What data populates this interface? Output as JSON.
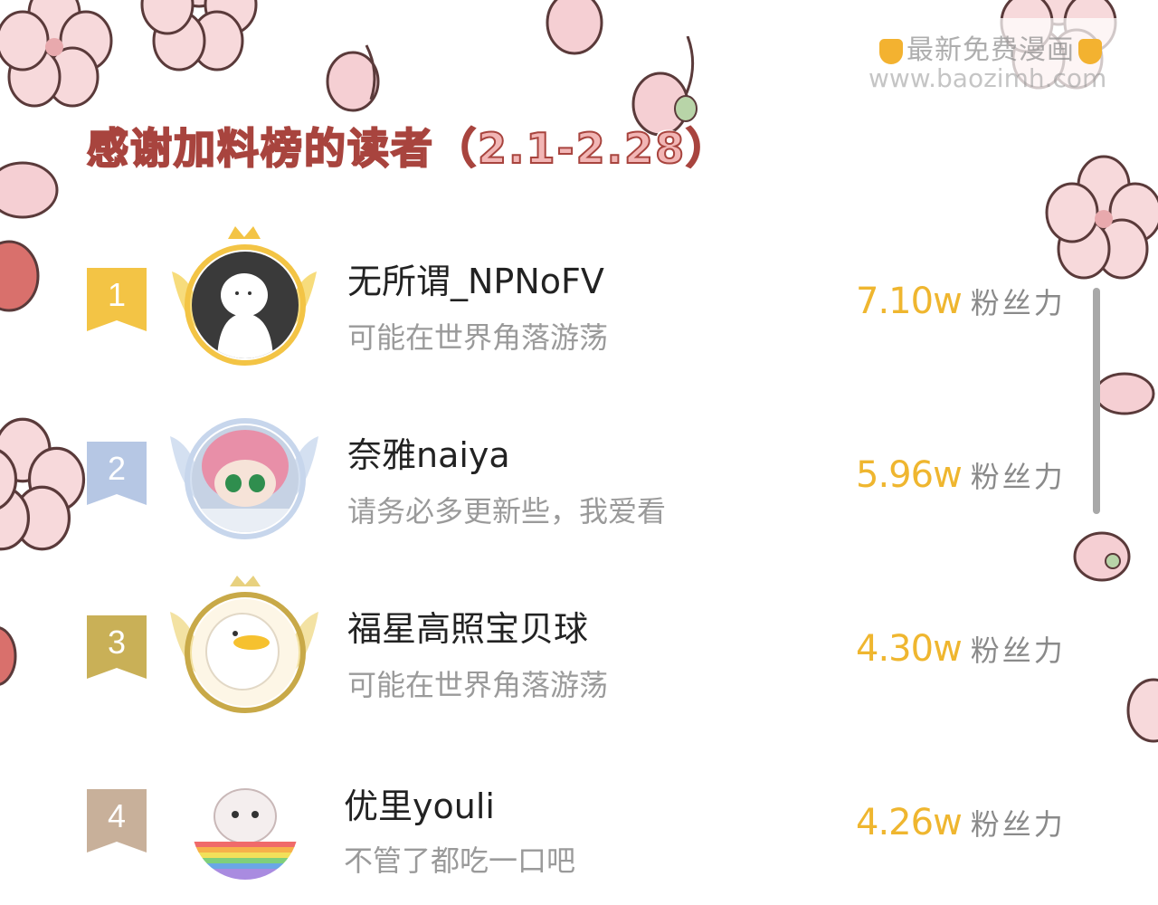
{
  "watermark": {
    "line1": "最新免费漫画",
    "line2": "www.baozimh.com"
  },
  "title": "感谢加料榜的读者（2.1-2.28）",
  "colors": {
    "title_fill": "#f2b6b5",
    "title_stroke": "#a8443e",
    "gold": "#f3c445",
    "silver": "#b6c7e4",
    "bronze": "#c9b057",
    "fourth": "#c8b09a",
    "fans_value": "#efb62f"
  },
  "ranking": [
    {
      "rank": "1",
      "name": "无所谓_NPNoFV",
      "signature": "可能在世界角落游荡",
      "fans_value": "7.10w",
      "fans_unit": "粉丝力",
      "badge_color": "#f3c445"
    },
    {
      "rank": "2",
      "name": "奈雅naiya",
      "signature": "请务必多更新些，我爱看",
      "fans_value": "5.96w",
      "fans_unit": "粉丝力",
      "badge_color": "#b6c7e4"
    },
    {
      "rank": "3",
      "name": "福星高照宝贝球",
      "signature": "可能在世界角落游荡",
      "fans_value": "4.30w",
      "fans_unit": "粉丝力",
      "badge_color": "#c9b057"
    },
    {
      "rank": "4",
      "name": "优里youli",
      "signature": "不管了都吃一口吧",
      "fans_value": "4.26w",
      "fans_unit": "粉丝力",
      "badge_color": "#c8b09a"
    }
  ]
}
